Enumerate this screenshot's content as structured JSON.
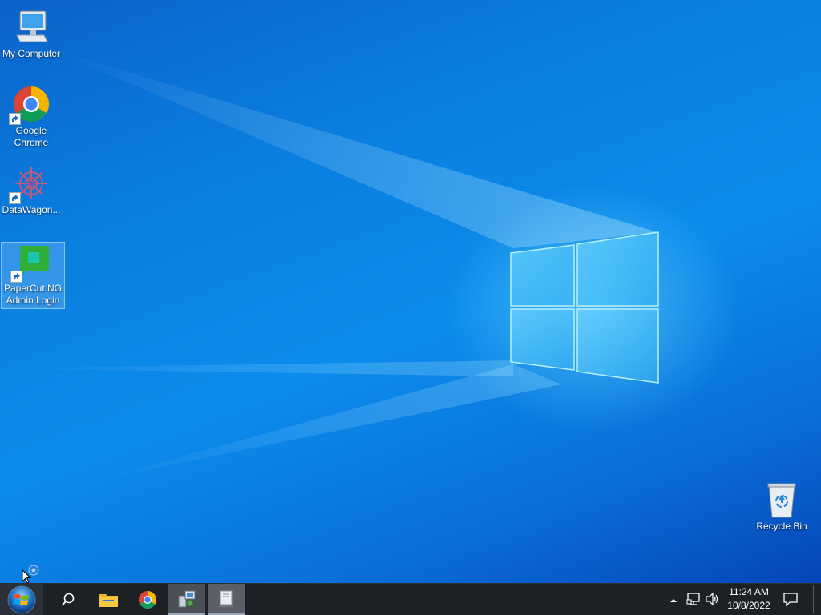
{
  "desktop": {
    "icons": [
      {
        "label": "My Computer",
        "icon": "computer-icon",
        "shortcut": false
      },
      {
        "label": "Google Chrome",
        "icon": "chrome-icon",
        "shortcut": true
      },
      {
        "label": "DataWagon...",
        "icon": "datawagon-icon",
        "shortcut": true
      },
      {
        "label": "PaperCut NG Admin Login",
        "icon": "papercut-icon",
        "shortcut": true,
        "selected": true
      },
      {
        "label": "Recycle Bin",
        "icon": "recycle-bin-icon",
        "shortcut": false
      }
    ]
  },
  "taskbar": {
    "start_icon": "windows-start-orb-icon",
    "items": [
      {
        "icon": "search-icon"
      },
      {
        "icon": "file-explorer-icon"
      },
      {
        "icon": "chrome-icon"
      },
      {
        "icon": "control-panel-icon"
      },
      {
        "icon": "server-app-icon",
        "active": true
      }
    ],
    "tray": {
      "icons": [
        "show-hidden-icons-chevron",
        "network-icon",
        "volume-icon"
      ],
      "time": "11:24 AM",
      "date": "10/8/2022",
      "notification_icon": "action-center-icon"
    }
  },
  "colors": {
    "desktop_blue": "#0a7fe0",
    "taskbar": "#1d2126",
    "chrome_red": "#db4437",
    "chrome_green": "#0f9d58",
    "chrome_yellow": "#f4b400",
    "chrome_blue": "#4285f4",
    "papercut_green": "#2fae3a"
  }
}
